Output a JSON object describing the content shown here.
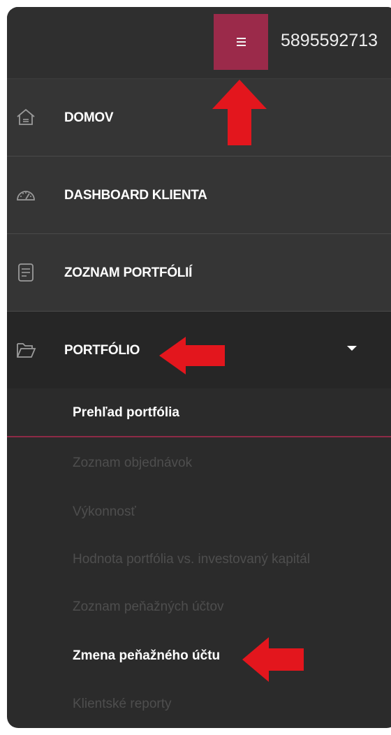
{
  "header": {
    "account_id": "5895592713",
    "menu_icon": "hamburger-icon"
  },
  "nav": [
    {
      "label": "DOMOV",
      "icon": "home-icon"
    },
    {
      "label": "DASHBOARD KLIENTA",
      "icon": "speedometer-icon"
    },
    {
      "label": "ZOZNAM PORTFÓLIÍ",
      "icon": "document-list-icon"
    },
    {
      "label": "PORTFÓLIO",
      "icon": "folder-open-icon",
      "expanded": true
    }
  ],
  "submenu": [
    {
      "label": "Prehľad portfólia",
      "state": "active"
    },
    {
      "label": "Zoznam objednávok",
      "state": "normal"
    },
    {
      "label": "Výkonnosť",
      "state": "normal"
    },
    {
      "label": "Hodnota portfólia vs. investovaný kapitál",
      "state": "normal"
    },
    {
      "label": "Zoznam peňažných účtov",
      "state": "normal"
    },
    {
      "label": "Zmena peňažného účtu",
      "state": "highlighted"
    },
    {
      "label": "Klientské reporty",
      "state": "normal"
    }
  ],
  "colors": {
    "accent": "#9b2a4a",
    "annotation_arrow": "#e3161d",
    "panel_bg": "#2b2b2b",
    "nav_bg": "#353535",
    "muted_text": "#4e4e4e"
  }
}
